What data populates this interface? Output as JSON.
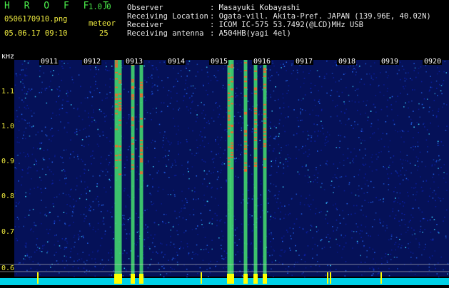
{
  "header": {
    "app_name": "H R O F F T",
    "version": "1.0.0",
    "filename": "0506170910.png",
    "datetime": "05.06.17 09:10",
    "meteor_label": "meteor",
    "meteor_count": "25",
    "info_labels": [
      "Observer",
      "Receiving Location",
      "Receiver",
      "Receiving antenna"
    ],
    "info_values": [
      ": Masayuki Kobayashi",
      ": Ogata-vill. Akita-Pref. JAPAN (139.96E, 40.02N)",
      ": ICOM IC-575 53.7492(@LCD)MHz USB",
      ": A504HB(yagi 4el)"
    ]
  },
  "spectrogram": {
    "unit_label": "kHz",
    "freq_ticks": [
      "1.1",
      "1.0",
      "0.9",
      "0.8",
      "0.7",
      "0.6"
    ],
    "time_labels": [
      "0911",
      "0912",
      "0913",
      "0914",
      "0915",
      "0916",
      "0917",
      "0918",
      "0919",
      "0920"
    ],
    "colors": {
      "background": "#000000",
      "noise_low": "#0a1fa0",
      "noise_mid": "#1f5adc",
      "noise_high": "#3ad0ff",
      "meteor_core": "#46e070",
      "meteor_hot": "#e86a30",
      "baseline": "#00e8ff",
      "peak": "#ffff00",
      "label_text": "#ffffff",
      "tick_text": "#f0ec40"
    }
  }
}
